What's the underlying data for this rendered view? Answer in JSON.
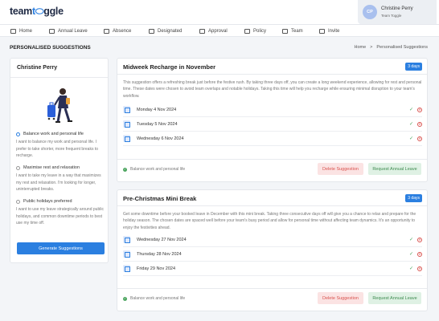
{
  "header": {
    "logo_part1": "team",
    "logo_accent": "t",
    "logo_part2": "ggle",
    "user": {
      "initials": "CP",
      "name": "Christine Perry",
      "org": "Team Toggle"
    }
  },
  "nav": {
    "items": [
      {
        "label": "Home",
        "icon": "home-icon"
      },
      {
        "label": "Annual Leave",
        "icon": "calendar-icon"
      },
      {
        "label": "Absence",
        "icon": "absence-icon"
      },
      {
        "label": "Designated",
        "icon": "designated-icon"
      },
      {
        "label": "Approval",
        "icon": "approval-icon"
      },
      {
        "label": "Policy",
        "icon": "policy-icon"
      },
      {
        "label": "Team",
        "icon": "team-icon"
      },
      {
        "label": "Invite",
        "icon": "invite-icon"
      }
    ]
  },
  "page": {
    "title": "PERSONALISED SUGGESTIONS",
    "breadcrumb": [
      "Home",
      ">",
      "Personalised Suggestions"
    ]
  },
  "left_panel": {
    "name": "Christine Perry",
    "options": [
      {
        "label": "Balance work and personal life",
        "selected": true,
        "description": "I want to balance my work and personal life. I prefer to take shorter, more frequent breaks to recharge."
      },
      {
        "label": "Maximise rest and relaxation",
        "selected": false,
        "description": "I want to take my leave in a way that maximizes my rest and relaxation. I'm looking for longer, uninterrupted breaks."
      },
      {
        "label": "Public holidays preferred",
        "selected": false,
        "description": "I want to use my leave strategically around public holidays, and common downtime periods to best use my time off."
      }
    ],
    "generate_button": "Generate Suggestions"
  },
  "cards": [
    {
      "title": "Midweek Recharge in November",
      "badge": "3 days",
      "description": "This suggestion offers a refreshing break just before the festive rush. By taking three days off, you can create a long weekend experience, allowing for rest and personal time. These dates were chosen to avoid team overlaps and notable holidays. Taking this time will help you recharge while ensuring minimal disruption to your team's workflow.",
      "dates": [
        "Monday 4 Nov 2024",
        "Tuesday 5 Nov 2024",
        "Wednesday 6 Nov 2024"
      ],
      "tag": "Balance work and personal life",
      "delete_label": "Delete Suggestion",
      "request_label": "Request Annual Leave"
    },
    {
      "title": "Pre-Christmas Mini Break",
      "badge": "3 days",
      "description": "Get some downtime before your booked leave in December with this mini break. Taking three consecutive days off will give you a chance to relax and prepare for the holiday season. The chosen dates are spaced well before your team's busy period and allow for personal time without affecting team dynamics. It's an opportunity to enjoy the festivities ahead.",
      "dates": [
        "Wednesday 27 Nov 2024",
        "Thursday 28 Nov 2024",
        "Friday 29 Nov 2024"
      ],
      "tag": "Balance work and personal life",
      "delete_label": "Delete Suggestion",
      "request_label": "Request Annual Leave"
    }
  ],
  "colors": {
    "primary": "#2b7fe0",
    "success": "#4ca55f",
    "danger": "#d9534f",
    "background": "#f3f5f8"
  }
}
